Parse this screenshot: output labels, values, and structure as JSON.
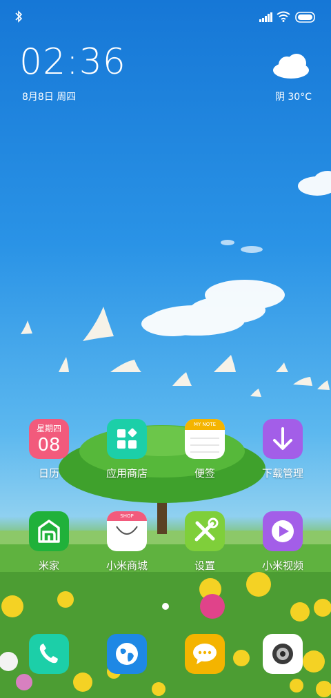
{
  "status_bar": {
    "icons": [
      "bluetooth-icon",
      "signal-icon",
      "wifi-icon",
      "battery-icon"
    ]
  },
  "clock_widget": {
    "time": "02:36",
    "date": "8月8日 周四"
  },
  "weather_widget": {
    "icon": "cloud-icon",
    "text": "阴   30°C"
  },
  "apps_row1": [
    {
      "label": "日历",
      "icon": "calendar-icon",
      "weekday": "星期四",
      "day": "08",
      "color": "#f25a7c"
    },
    {
      "label": "应用商店",
      "icon": "app-store-icon",
      "color": "#1ccfa8"
    },
    {
      "label": "便签",
      "icon": "notes-icon",
      "header": "MY NOTE",
      "color": "#f4b400"
    },
    {
      "label": "下载管理",
      "icon": "download-icon",
      "color": "#a35ee8"
    }
  ],
  "apps_row2": [
    {
      "label": "米家",
      "icon": "mi-home-icon",
      "color": "#20b13a"
    },
    {
      "label": "小米商城",
      "icon": "shop-icon",
      "header": "SHOP",
      "color": "#f25a7c"
    },
    {
      "label": "设置",
      "icon": "settings-icon",
      "color": "#7fcf3a"
    },
    {
      "label": "小米视频",
      "icon": "video-icon",
      "color": "#a35ee8"
    }
  ],
  "page_indicator": {
    "pages": 1,
    "active": 1
  },
  "dock": [
    {
      "icon": "phone-icon",
      "color": "#1ccfa8"
    },
    {
      "icon": "browser-icon",
      "color": "#1e88e5"
    },
    {
      "icon": "messages-icon",
      "color": "#f4b400"
    },
    {
      "icon": "camera-icon",
      "color": "#ffffff"
    }
  ]
}
